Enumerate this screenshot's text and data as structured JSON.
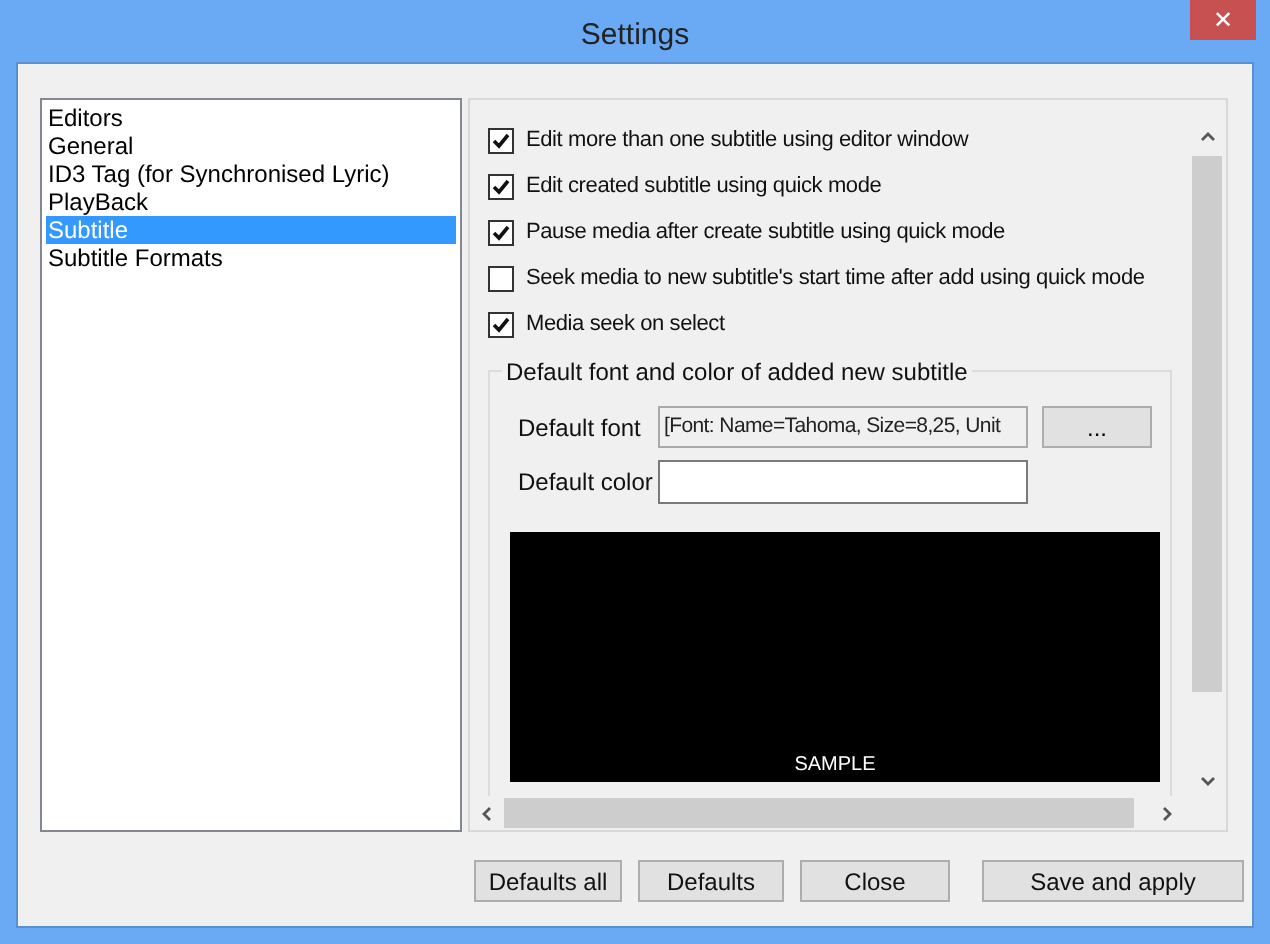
{
  "window": {
    "title": "Settings",
    "close": "✕"
  },
  "sidebar": {
    "items": [
      {
        "label": "Editors",
        "selected": false
      },
      {
        "label": "General",
        "selected": false
      },
      {
        "label": "ID3 Tag (for Synchronised Lyric)",
        "selected": false
      },
      {
        "label": "PlayBack",
        "selected": false
      },
      {
        "label": "Subtitle",
        "selected": true
      },
      {
        "label": "Subtitle Formats",
        "selected": false
      }
    ]
  },
  "options": [
    {
      "label": "Edit more than one subtitle using editor window",
      "checked": true
    },
    {
      "label": "Edit created subtitle using quick mode",
      "checked": true
    },
    {
      "label": "Pause media after create subtitle using quick mode",
      "checked": true
    },
    {
      "label": "Seek media to new subtitle's start time after add using quick mode",
      "checked": false
    },
    {
      "label": "Media seek on select",
      "checked": true
    }
  ],
  "group": {
    "title": "Default font and color of added new subtitle",
    "font_label": "Default font",
    "font_value": "[Font: Name=Tahoma, Size=8,25, Unit",
    "browse": "...",
    "color_label": "Default color",
    "sample": "SAMPLE"
  },
  "buttons": [
    "Defaults all",
    "Defaults",
    "Close",
    "Save and apply"
  ]
}
